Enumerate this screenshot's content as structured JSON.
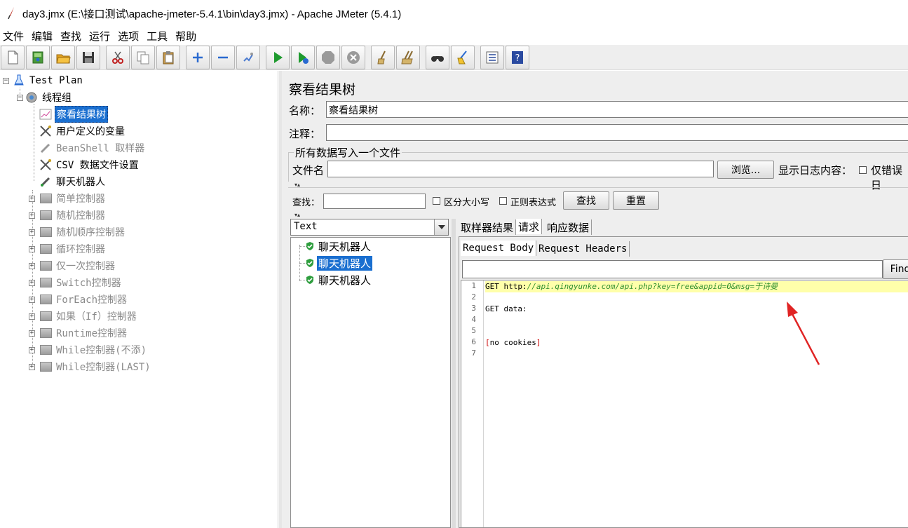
{
  "window": {
    "title": "day3.jmx (E:\\接口测试\\apache-jmeter-5.4.1\\bin\\day3.jmx) - Apache JMeter (5.4.1)"
  },
  "menu": [
    "文件",
    "编辑",
    "查找",
    "运行",
    "选项",
    "工具",
    "帮助"
  ],
  "toolbar": {
    "buttons": [
      "new-icon",
      "templates-icon",
      "open-icon",
      "save-icon",
      "cut-icon",
      "copy-icon",
      "paste-icon",
      "expand-icon",
      "collapse-icon",
      "toggle-icon",
      "start-icon",
      "start-no-pause-icon",
      "stop-icon",
      "shutdown-icon",
      "clear-icon",
      "clear-all-icon",
      "search-icon",
      "reset-search-icon",
      "function-helper-icon",
      "help-icon"
    ]
  },
  "tree": {
    "items": [
      {
        "label": "Test Plan",
        "icon": "flask-icon"
      },
      {
        "label": "线程组",
        "icon": "gear-icon"
      },
      {
        "label": "察看结果树",
        "icon": "chart-icon",
        "selected": true
      },
      {
        "label": "用户定义的变量",
        "icon": "tools-icon"
      },
      {
        "label": "BeanShell 取样器",
        "icon": "pipette-icon",
        "disabled": true
      },
      {
        "label": "CSV 数据文件设置",
        "icon": "tools-icon"
      },
      {
        "label": "聊天机器人",
        "icon": "pipette-icon"
      },
      {
        "label": "简单控制器",
        "icon": "box-icon",
        "disabled": true
      },
      {
        "label": "随机控制器",
        "icon": "box-icon",
        "disabled": true
      },
      {
        "label": "随机顺序控制器",
        "icon": "box-icon",
        "disabled": true
      },
      {
        "label": "循环控制器",
        "icon": "box-icon",
        "disabled": true
      },
      {
        "label": "仅一次控制器",
        "icon": "box-icon",
        "disabled": true
      },
      {
        "label": "Switch控制器",
        "icon": "box-icon",
        "disabled": true
      },
      {
        "label": "ForEach控制器",
        "icon": "box-icon",
        "disabled": true
      },
      {
        "label": "如果（If）控制器",
        "icon": "box-icon",
        "disabled": true
      },
      {
        "label": "Runtime控制器",
        "icon": "box-icon",
        "disabled": true
      },
      {
        "label": "While控制器(不添)",
        "icon": "box-icon",
        "disabled": true
      },
      {
        "label": "While控制器(LAST)",
        "icon": "box-icon",
        "disabled": true
      }
    ]
  },
  "panel": {
    "title": "察看结果树",
    "name_label": "名称：",
    "name_value": "察看结果树",
    "comment_label": "注释：",
    "comment_value": "",
    "file_group_legend": "所有数据写入一个文件",
    "filename_label": "文件名",
    "filename_value": "",
    "browse_label": "浏览...",
    "log_label": "显示日志内容：",
    "errors_only_label": "仅错误日"
  },
  "search": {
    "label": "查找：",
    "value": "",
    "case_label": "区分大小写",
    "regex_label": "正则表达式",
    "find_label": "查找",
    "reset_label": "重置"
  },
  "results": {
    "renderer": "Text",
    "items": [
      {
        "label": "聊天机器人",
        "status": "success",
        "selected": false
      },
      {
        "label": "聊天机器人",
        "status": "success",
        "selected": true
      },
      {
        "label": "聊天机器人",
        "status": "success",
        "selected": false
      }
    ]
  },
  "detail": {
    "tabs": [
      "取样器结果",
      "请求",
      "响应数据"
    ],
    "active_tab": "请求",
    "subtabs": [
      "Request Body",
      "Request Headers"
    ],
    "active_subtab": "Request Body",
    "find_label": "Find",
    "code": {
      "line_numbers": [
        "1",
        "2",
        "3",
        "4",
        "5",
        "6",
        "7"
      ],
      "line1_method": "GET http:",
      "line1_url": "//api.qingyunke.com/api.php?key=free&appid=0&msg=于诗曼",
      "line3": "GET data:",
      "line6_open": "[",
      "line6_text": "no cookies",
      "line6_close": "]"
    }
  },
  "colors": {
    "selection": "#1a6fd0",
    "highlight_line": "#ffffaa",
    "url_green": "#2f8f2f",
    "annotation_arrow": "#e02424",
    "success_green": "#2e9e3e"
  }
}
